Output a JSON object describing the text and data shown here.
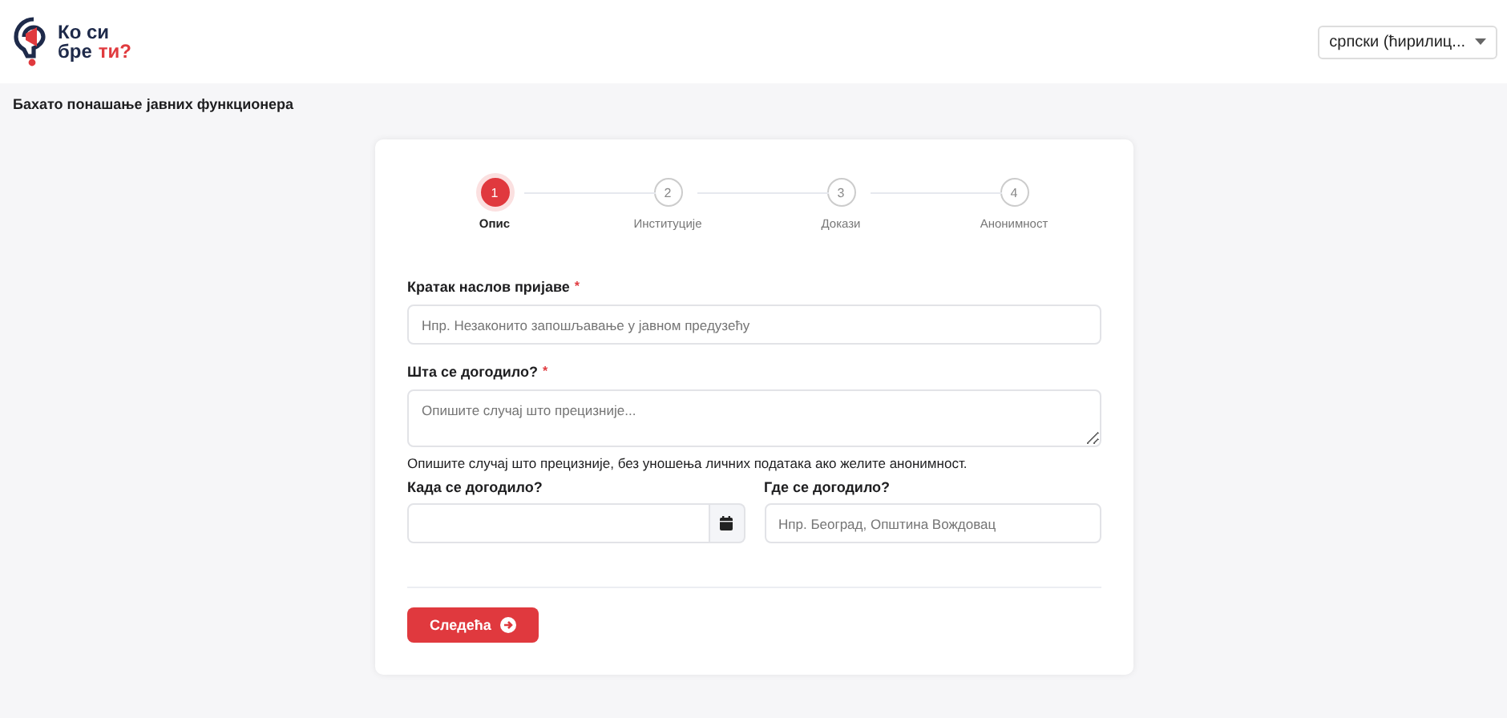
{
  "logo": {
    "line1": "Ко си",
    "line2a": "бре",
    "line2b": "ти?"
  },
  "language": {
    "value": "српски (ћирилиц..."
  },
  "page_title": "Бахато понашање јавних функционера",
  "steps": [
    {
      "number": "1",
      "label": "Опис",
      "selected": true
    },
    {
      "number": "2",
      "label": "Институције",
      "selected": false
    },
    {
      "number": "3",
      "label": "Докази",
      "selected": false
    },
    {
      "number": "4",
      "label": "Анонимност",
      "selected": false
    }
  ],
  "form": {
    "title_label": "Кратак наслов пријаве",
    "title_required_mark": "*",
    "title_placeholder": "Нпр. Незаконито запошљавање у јавном предузећу",
    "what_label": "Шта се догодило?",
    "what_required_mark": "*",
    "what_placeholder": "Опишите случај што прецизније...",
    "what_help": "Опишите случај што прецизније, без уношења личних података ако желите анонимност.",
    "when_label": "Када се догодило?",
    "where_label": "Где се догодило?",
    "where_placeholder": "Нпр. Београд, Општина Вождовац",
    "next_button": "Следећа"
  }
}
